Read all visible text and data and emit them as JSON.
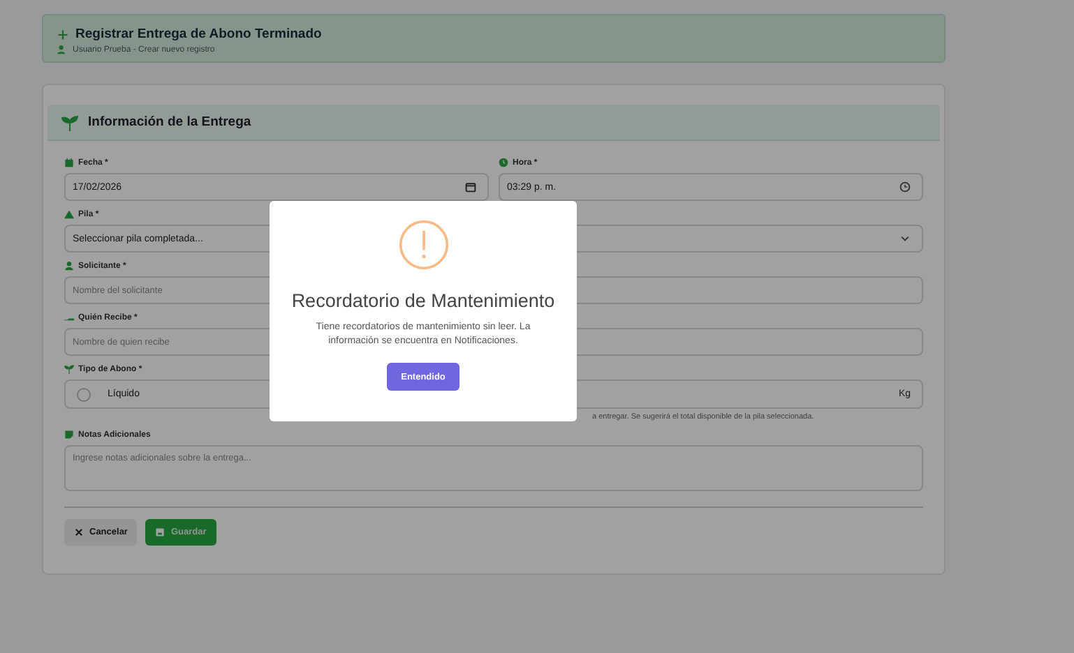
{
  "header": {
    "title": "Registrar Entrega de Abono Terminado",
    "subtitle": "Usuario Prueba - Crear nuevo registro"
  },
  "section": {
    "title": "Información de la Entrega"
  },
  "rows": [
    {
      "fields": [
        {
          "kind": "date",
          "label": "Fecha *",
          "value": "17/02/2026"
        },
        {
          "kind": "time",
          "label": "Hora *",
          "value": "03:29 p. m."
        }
      ]
    },
    {
      "fields": [
        {
          "kind": "select",
          "label": "Pila *",
          "value": "Seleccionar pila completada..."
        }
      ]
    },
    {
      "fields": [
        {
          "kind": "text",
          "label": "Solicitante *",
          "placeholder": "Nombre del solicitante"
        }
      ]
    },
    {
      "fields": [
        {
          "kind": "text",
          "label": "Quién Recibe *",
          "placeholder": "Nombre de quien recibe"
        }
      ]
    },
    {
      "fields": [
        {
          "kind": "radio",
          "label": "Tipo de Abono *",
          "option": "Líquido",
          "selected": false
        },
        {
          "kind": "number",
          "unit": "Kg",
          "hint": "a entregar. Se sugerirá el total disponible de la pila seleccionada."
        }
      ]
    },
    {
      "fields": [
        {
          "kind": "textarea",
          "label": "Notas Adicionales",
          "placeholder": "Ingrese notas adicionales sobre la entrega..."
        }
      ]
    }
  ],
  "buttons": [
    {
      "kind": "cancel",
      "label": "Cancelar"
    },
    {
      "kind": "save",
      "label": "Guardar"
    }
  ],
  "modal": {
    "title": "Recordatorio de Mantenimiento",
    "message": "Tiene recordatorios de mantenimiento sin leer. La información se encuentra en Notificaciones.",
    "button": "Entendido"
  }
}
